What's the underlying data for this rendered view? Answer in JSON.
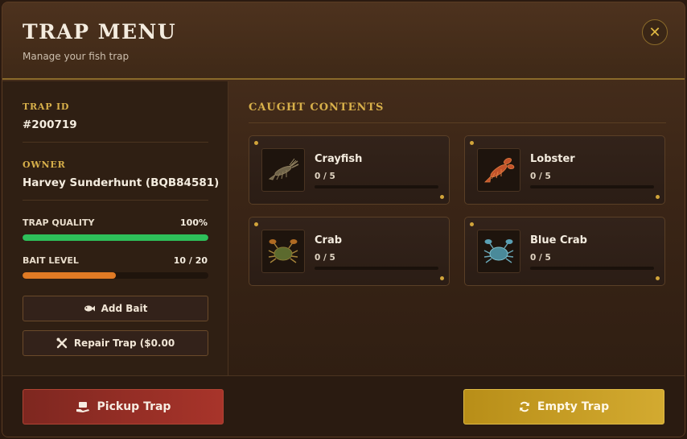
{
  "header": {
    "title": "TRAP MENU",
    "subtitle": "Manage your fish trap",
    "close_label": "✕"
  },
  "sidebar": {
    "trap_id_label": "TRAP ID",
    "trap_id": "#200719",
    "owner_label": "OWNER",
    "owner": "Harvey Sunderhunt (BQB84581)",
    "quality_label": "TRAP QUALITY",
    "quality_value": "100%",
    "quality_fraction": 1.0,
    "quality_color": "#2ec05a",
    "bait_label": "BAIT LEVEL",
    "bait_value": "10 / 20",
    "bait_fraction": 0.5,
    "bait_color": "#e07a24",
    "add_bait_label": "Add Bait",
    "repair_label": "Repair Trap ($0.00"
  },
  "main": {
    "section_title": "CAUGHT CONTENTS",
    "items": [
      {
        "name": "Crayfish",
        "count": "0 / 5",
        "icon": "crayfish-icon"
      },
      {
        "name": "Lobster",
        "count": "0 / 5",
        "icon": "lobster-icon"
      },
      {
        "name": "Crab",
        "count": "0 / 5",
        "icon": "crab-icon"
      },
      {
        "name": "Blue Crab",
        "count": "0 / 5",
        "icon": "blue-crab-icon"
      }
    ]
  },
  "footer": {
    "pickup_label": "Pickup Trap",
    "empty_label": "Empty Trap"
  },
  "colors": {
    "accent_gold": "#d8b04a",
    "danger_red": "#a8342a",
    "primary_gold": "#d3aa30"
  }
}
